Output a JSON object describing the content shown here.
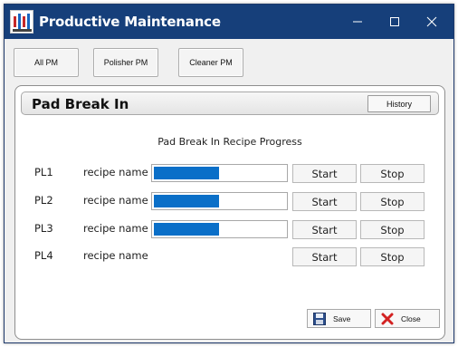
{
  "window": {
    "title": "Productive Maintenance",
    "controls": {
      "minimize_icon": "minimize-icon",
      "maximize_icon": "maximize-icon",
      "close_icon": "close-icon"
    },
    "colors": {
      "titlebar": "#163f7a",
      "progress": "#0a6fc8"
    }
  },
  "toolbar": {
    "buttons": [
      "All PM",
      "Polisher PM",
      "Cleaner PM"
    ]
  },
  "panel": {
    "title": "Pad Break In",
    "history_label": "History",
    "progress_heading": "Pad Break In Recipe Progress",
    "rows": [
      {
        "label": "PL1",
        "recipe": "recipe name",
        "progress": 0.49,
        "show_progress": true,
        "start": "Start",
        "stop": "Stop"
      },
      {
        "label": "PL2",
        "recipe": "recipe name",
        "progress": 0.49,
        "show_progress": true,
        "start": "Start",
        "stop": "Stop"
      },
      {
        "label": "PL3",
        "recipe": "recipe name",
        "progress": 0.49,
        "show_progress": true,
        "start": "Start",
        "stop": "Stop"
      },
      {
        "label": "PL4",
        "recipe": "recipe name",
        "progress": 0,
        "show_progress": false,
        "start": "Start",
        "stop": "Stop"
      }
    ],
    "save_label": "Save",
    "close_label": "Close"
  }
}
